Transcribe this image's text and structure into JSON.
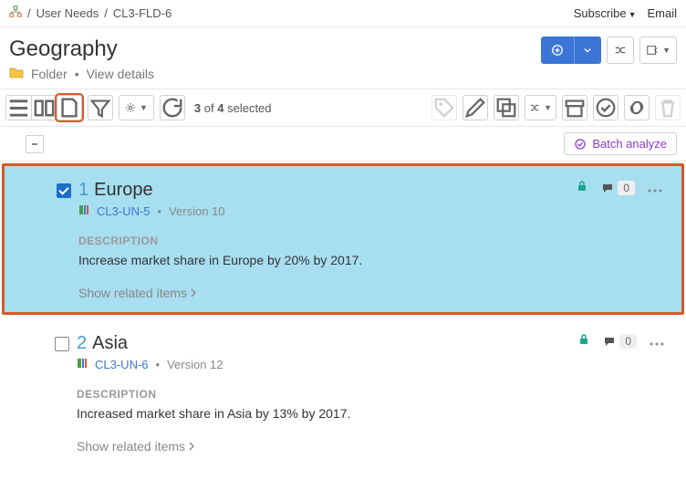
{
  "breadcrumb": {
    "parent": "User Needs",
    "current": "CL3-FLD-6"
  },
  "top_links": {
    "subscribe": "Subscribe",
    "email": "Email"
  },
  "page": {
    "title": "Geography",
    "type_label": "Folder",
    "details_link": "View details"
  },
  "toolbar": {
    "selection_count": "3",
    "selection_total": "4",
    "selection_label": "selected",
    "batch_analyze": "Batch analyze"
  },
  "items": [
    {
      "checked": true,
      "num": "1",
      "name": "Europe",
      "id": "CL3-UN-5",
      "version": "Version 10",
      "comment_count": "0",
      "desc_label": "DESCRIPTION",
      "description": "Increase market share in Europe by 20% by 2017.",
      "related": "Show related items"
    },
    {
      "checked": false,
      "num": "2",
      "name": "Asia",
      "id": "CL3-UN-6",
      "version": "Version 12",
      "comment_count": "0",
      "desc_label": "DESCRIPTION",
      "description": "Increased market share in Asia by 13% by 2017.",
      "related": "Show related items"
    }
  ]
}
